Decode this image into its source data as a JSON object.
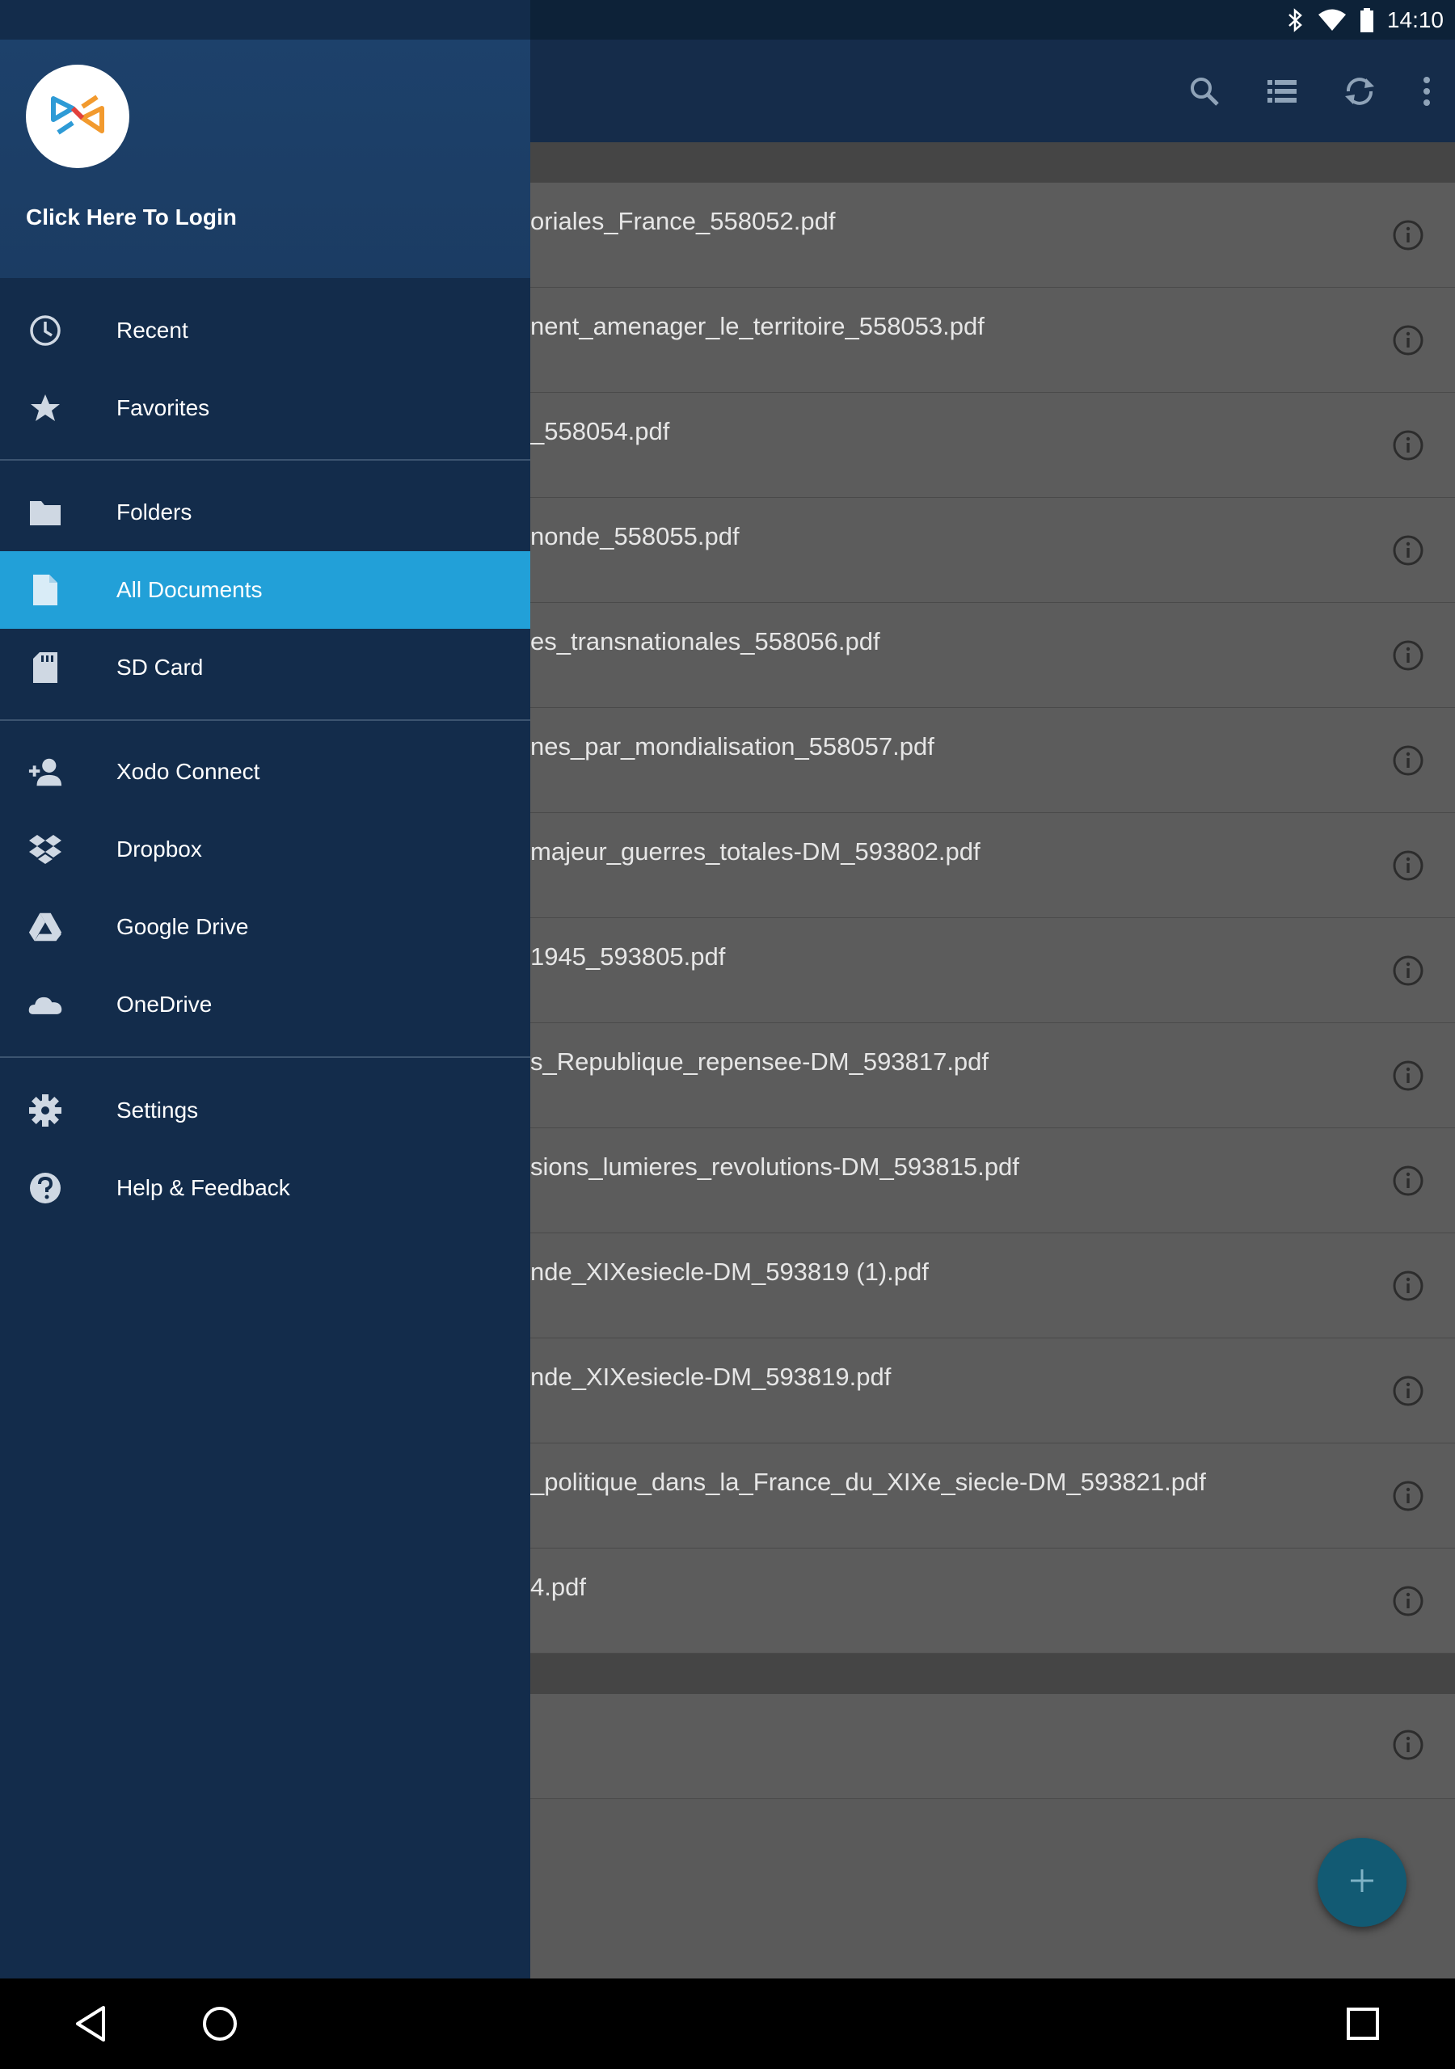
{
  "status_bar": {
    "time": "14:10",
    "icons": [
      "bluetooth-icon",
      "wifi-icon",
      "battery-icon"
    ]
  },
  "app_bar": {
    "actions": [
      "search-icon",
      "list-view-icon",
      "sync-icon",
      "overflow-menu-icon"
    ]
  },
  "drawer": {
    "login_label": "Click Here To Login",
    "groups": [
      [
        {
          "label": "Recent",
          "icon": "clock-icon"
        },
        {
          "label": "Favorites",
          "icon": "star-icon"
        }
      ],
      [
        {
          "label": "Folders",
          "icon": "folder-icon"
        },
        {
          "label": "All Documents",
          "icon": "document-icon",
          "selected": true
        },
        {
          "label": "SD Card",
          "icon": "sd-card-icon"
        }
      ],
      [
        {
          "label": "Xodo Connect",
          "icon": "add-person-icon"
        },
        {
          "label": "Dropbox",
          "icon": "dropbox-icon"
        },
        {
          "label": "Google Drive",
          "icon": "google-drive-icon"
        },
        {
          "label": "OneDrive",
          "icon": "onedrive-icon"
        }
      ],
      [
        {
          "label": "Settings",
          "icon": "gear-icon"
        },
        {
          "label": "Help & Feedback",
          "icon": "help-icon"
        }
      ]
    ]
  },
  "documents": {
    "section1": [
      "oriales_France_558052.pdf",
      "nent_amenager_le_territoire_558053.pdf",
      "_558054.pdf",
      "nonde_558055.pdf",
      "es_transnationales_558056.pdf",
      "nes_par_mondialisation_558057.pdf",
      "majeur_guerres_totales-DM_593802.pdf",
      "1945_593805.pdf",
      "s_Republique_repensee-DM_593817.pdf",
      "sions_lumieres_revolutions-DM_593815.pdf",
      "nde_XIXesiecle-DM_593819 (1).pdf",
      "nde_XIXesiecle-DM_593819.pdf",
      "_politique_dans_la_France_du_XIXe_siecle-DM_593821.pdf",
      "4.pdf"
    ],
    "section2": [
      ""
    ]
  },
  "fab": {
    "icon": "plus-icon"
  },
  "nav_bar": [
    "back-icon",
    "home-icon",
    "recents-icon"
  ],
  "colors": {
    "drawer_bg": "#132c4b",
    "drawer_header": "#1d416b",
    "selected": "#22a0d8",
    "appbar": "#152c4a",
    "fab": "#125a73"
  }
}
